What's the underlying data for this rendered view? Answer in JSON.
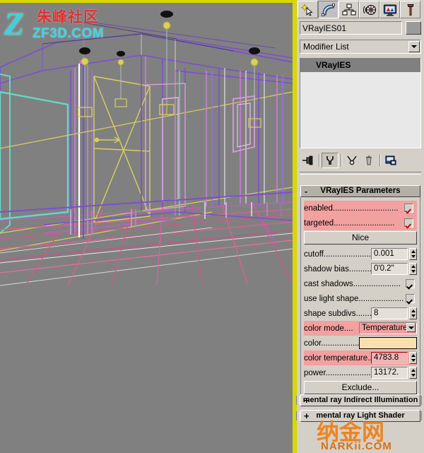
{
  "app": {
    "viewport_label": "Perspective viewport - wireframe interior scene with VRayIES lights"
  },
  "watermarks": {
    "top_left_cn": "朱峰社区",
    "top_left_domain": "ZF3D.COM",
    "top_left_initial": "Z",
    "bottom_right_cn": "纳金网",
    "bottom_right_domain": "NARKii.COM"
  },
  "command_panel": {
    "tabs": [
      {
        "name": "create",
        "icon": "star-cursor-icon",
        "active": false
      },
      {
        "name": "modify",
        "icon": "arc-curve-icon",
        "active": true
      },
      {
        "name": "hierarchy",
        "icon": "hierarchy-tree-icon",
        "active": false
      },
      {
        "name": "motion",
        "icon": "motion-wheel-icon",
        "active": false
      },
      {
        "name": "display",
        "icon": "display-monitor-icon",
        "active": false
      },
      {
        "name": "utilities",
        "icon": "hammer-icon",
        "active": false
      }
    ],
    "object_name": "VRayIES01",
    "object_color": "#9a9a9a",
    "modifier_list_label": "Modifier List",
    "modifier_stack": [
      {
        "label": "VRayIES",
        "selected": true
      }
    ],
    "stack_tools": [
      {
        "name": "pin-stack",
        "icon": "pin-icon"
      },
      {
        "name": "show-end-result",
        "icon": "show-end-result-icon",
        "pressed": true
      },
      {
        "name": "make-unique",
        "icon": "make-unique-icon"
      },
      {
        "name": "remove-modifier",
        "icon": "trash-icon"
      },
      {
        "name": "configure-modifier-sets",
        "icon": "configure-sets-icon"
      }
    ]
  },
  "rollout": {
    "title": "VRayIES Parameters",
    "collapse_sign": "-",
    "rows": {
      "enabled": {
        "label": "enabled.............................",
        "checked": true,
        "animated": true
      },
      "targeted": {
        "label": "targeted...........................",
        "checked": true,
        "animated": true
      },
      "ies_file_button": "Nice",
      "cutoff": {
        "label": "cutoff.......................",
        "value": "0.001"
      },
      "shadow_bias": {
        "label": "shadow bias...........",
        "value": "0'0.2\""
      },
      "cast_shadows": {
        "label": "cast shadows.....................",
        "checked": true
      },
      "use_light_shape": {
        "label": "use light shape....................",
        "checked": true
      },
      "shape_subdivs": {
        "label": "shape subdivs........",
        "value": "8"
      },
      "color_mode": {
        "label": "color mode....",
        "value": "Temperature",
        "animated": true
      },
      "color": {
        "label": "color.................",
        "swatch": "#fbe0af"
      },
      "color_temperature": {
        "label": "color temperature....",
        "value": "4783.8",
        "animated": true
      },
      "power": {
        "label": "power.........................",
        "value": "13172."
      },
      "exclude_button": "Exclude..."
    }
  },
  "bottom_rollouts": [
    {
      "label": "mental ray Indirect Illumination",
      "sign": "+"
    },
    {
      "label": "mental ray Light Shader",
      "sign": "+"
    }
  ],
  "colors": {
    "panel_bg": "#d4d0c8",
    "animated_highlight": "#f2a0a0",
    "viewport_bg": "#808080",
    "active_viewport_border": "#d8d800",
    "wall_violet": "#7b4fd0",
    "wall_magenta": "#c97fd8",
    "window_cyan": "#63d8c8",
    "light_yellow": "#d8d05a",
    "floor_pink": "#e06090",
    "stack_selected": "#808080"
  }
}
